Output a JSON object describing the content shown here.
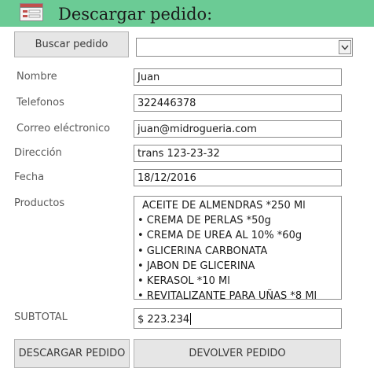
{
  "header": {
    "title": "Descargar pedido:",
    "background": "#6bcb95",
    "icon": "form-icon"
  },
  "search": {
    "button_label": "Buscar pedido",
    "combo_value": "",
    "dropdown_icon": "chevron-down-icon"
  },
  "fields": {
    "nombre": {
      "label": "Nombre",
      "value": "Juan"
    },
    "telefonos": {
      "label": "Telefonos",
      "value": "322446378"
    },
    "correo": {
      "label": "Correo eléctronico",
      "value": "juan@midrogueria.com"
    },
    "direccion": {
      "label": "Dirección",
      "value": "trans 123-23-32"
    },
    "fecha": {
      "label": "Fecha",
      "value": "18/12/2016"
    }
  },
  "products": {
    "label": "Productos",
    "items": [
      "ACEITE DE ALMENDRAS *250 Ml",
      "• CREMA DE PERLAS *50g",
      "• CREMA DE UREA AL 10% *60g",
      "• GLICERINA CARBONATA",
      "• JABON DE GLICERINA",
      "• KERASOL *10 Ml",
      "• REVITALIZANTE PARA UÑAS *8 Ml"
    ]
  },
  "subtotal": {
    "label": "SUBTOTAL",
    "value": "$ 223.234"
  },
  "actions": {
    "download_label": "DESCARGAR PEDIDO",
    "return_label": "DEVOLVER PEDIDO"
  }
}
